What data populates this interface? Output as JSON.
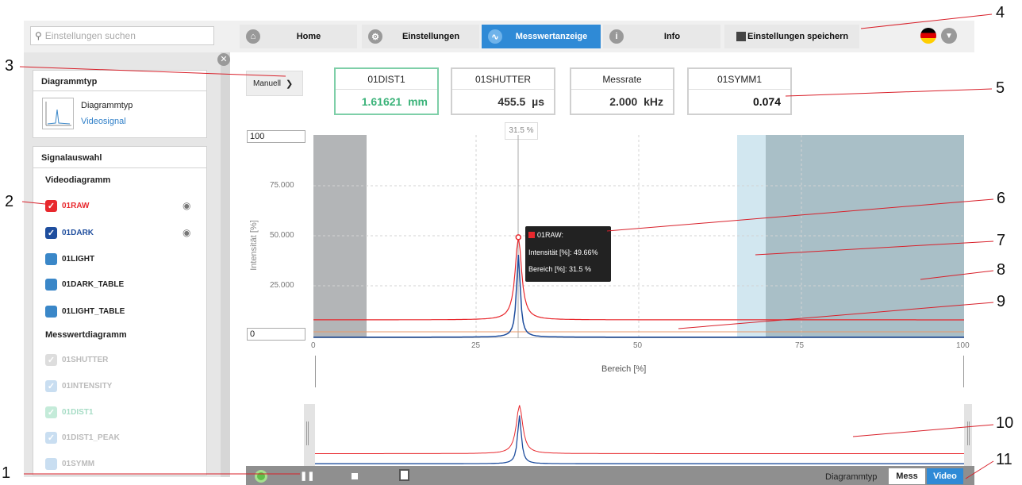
{
  "search": {
    "placeholder": "Einstellungen suchen"
  },
  "nav": {
    "home": "Home",
    "settings": "Einstellungen",
    "measure": "Messwertanzeige",
    "info": "Info",
    "save": "Einstellungen speichern"
  },
  "sidebar": {
    "diagramtype_header": "Diagrammtyp",
    "diagramtype_label": "Diagrammtyp",
    "diagramtype_value": "Videosignal",
    "signal_header": "Signalauswahl",
    "video_header": "Videodiagramm",
    "video_items": [
      {
        "label": "01RAW",
        "color": "#e8282d",
        "checked": true
      },
      {
        "label": "01DARK",
        "color": "#1f4e9e",
        "checked": true
      },
      {
        "label": "01LIGHT",
        "color": "#3a87c8",
        "checked": false
      },
      {
        "label": "01DARK_TABLE",
        "color": "#3a87c8",
        "checked": false
      },
      {
        "label": "01LIGHT_TABLE",
        "color": "#3a87c8",
        "checked": false
      }
    ],
    "measure_header": "Messwertdiagramm",
    "measure_items": [
      "01SHUTTER",
      "01INTENSITY",
      "01DIST1",
      "01DIST1_PEAK",
      "01SYMM"
    ]
  },
  "mode": {
    "value": "Manuell"
  },
  "values": [
    {
      "name": "01DIST1",
      "value": "1.61621",
      "unit": "mm",
      "color": "#3cb37a"
    },
    {
      "name": "01SHUTTER",
      "value": "455.5",
      "unit": "µs",
      "color": "#333333"
    },
    {
      "name": "Messrate",
      "value": "2.000",
      "unit": "kHz",
      "color": "#333333"
    },
    {
      "name": "01SYMM1",
      "value": "0.074",
      "unit": "",
      "color": "#111111"
    }
  ],
  "chart": {
    "ymax_input": "100",
    "ymin_input": "0",
    "cursor_label": "31.5 %",
    "ylabel": "Intensität [%]",
    "xlabel": "Bereich [%]",
    "yticks": [
      "75.000",
      "50.000",
      "25.000"
    ],
    "xticks": [
      "0",
      "25",
      "50",
      "75",
      "100"
    ],
    "tooltip": {
      "title": "01RAW:",
      "line1": "Intensität [%]: 49.66%",
      "line2": "Bereich [%]: 31.5 %"
    }
  },
  "chart_data": {
    "type": "line",
    "xlim": [
      0,
      100
    ],
    "ylim": [
      0,
      100
    ],
    "peak_x": 31.5,
    "series": [
      {
        "name": "01RAW",
        "color": "#e8282d",
        "baseline": 9,
        "peak": 49.66
      },
      {
        "name": "01DARK",
        "color": "#1f4e9e",
        "baseline": 0.5,
        "peak": 41
      }
    ],
    "threshold_line": {
      "color": "#e89a6a",
      "y": 3
    }
  },
  "bottom": {
    "diagramtype_label": "Diagrammtyp",
    "mess": "Mess",
    "video": "Video"
  },
  "callouts": [
    "1",
    "2",
    "3",
    "4",
    "5",
    "6",
    "7",
    "8",
    "9",
    "10",
    "11"
  ]
}
